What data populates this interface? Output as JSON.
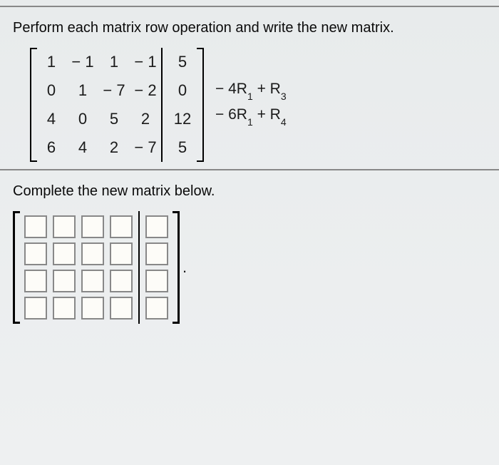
{
  "instruction": "Perform each matrix row operation and write the new matrix.",
  "matrix": {
    "rows": [
      {
        "left": [
          "1",
          "− 1",
          "1",
          "− 1"
        ],
        "right": "5"
      },
      {
        "left": [
          "0",
          "1",
          "− 7",
          "− 2"
        ],
        "right": "0"
      },
      {
        "left": [
          "4",
          "0",
          "5",
          "2"
        ],
        "right": "12"
      },
      {
        "left": [
          "6",
          "4",
          "2",
          "− 7"
        ],
        "right": "5"
      }
    ]
  },
  "operations": {
    "op1": {
      "coef": "− 4R",
      "sub1": "1",
      "plus": " + R",
      "sub2": "3"
    },
    "op2": {
      "coef": "− 6R",
      "sub1": "1",
      "plus": " + R",
      "sub2": "4"
    }
  },
  "complete_text": "Complete the new matrix below.",
  "period": "."
}
